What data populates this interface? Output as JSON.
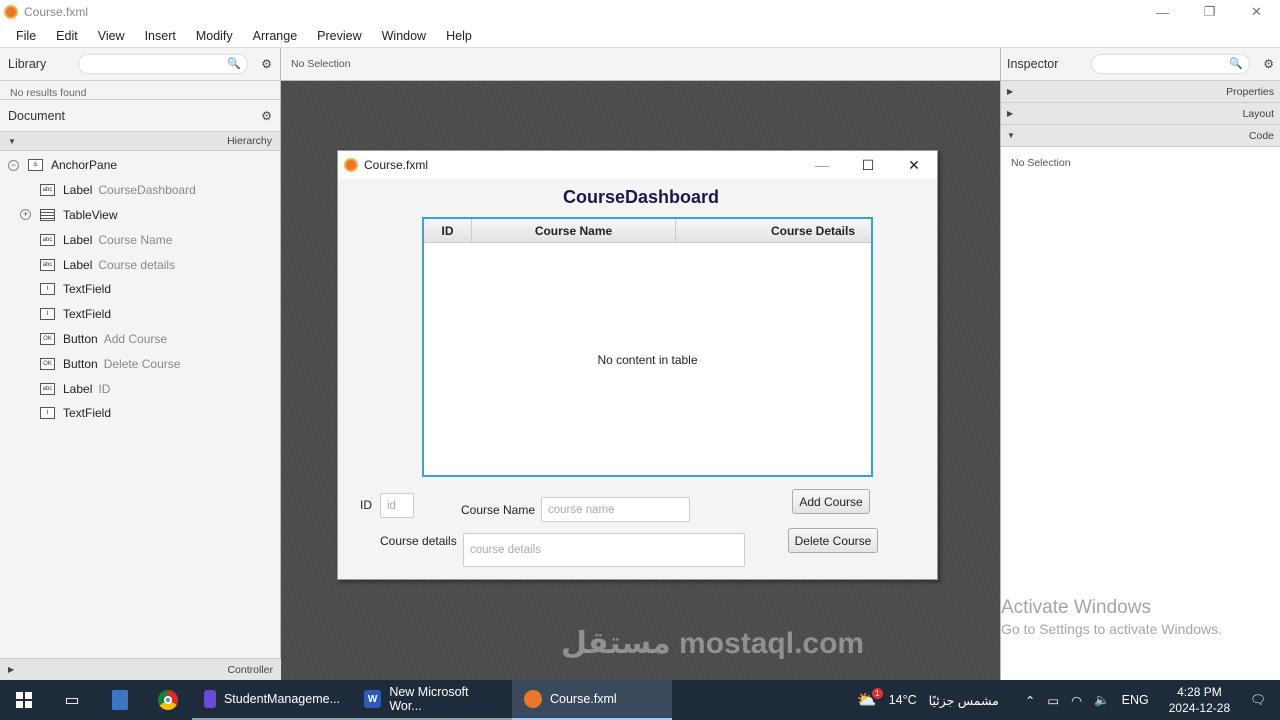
{
  "window": {
    "title": "Course.fxml",
    "minimize": "—",
    "maximize": "❐",
    "close": "✕"
  },
  "menu": [
    "File",
    "Edit",
    "View",
    "Insert",
    "Modify",
    "Arrange",
    "Preview",
    "Window",
    "Help"
  ],
  "library": {
    "label": "Library",
    "no_results": "No results found"
  },
  "document": {
    "label": "Document",
    "hierarchy": "Hierarchy",
    "controller": "Controller",
    "tree": [
      {
        "type": "AnchorPane",
        "text": "",
        "icon": "anchor-icon"
      },
      {
        "type": "Label",
        "text": "CourseDashboard",
        "icon": "abc"
      },
      {
        "type": "TableView",
        "text": "",
        "icon": "table-icon"
      },
      {
        "type": "Label",
        "text": "Course Name",
        "icon": "abc"
      },
      {
        "type": "Label",
        "text": "Course details",
        "icon": "abc"
      },
      {
        "type": "TextField",
        "text": "",
        "icon": "I"
      },
      {
        "type": "TextField",
        "text": "",
        "icon": "I"
      },
      {
        "type": "Button",
        "text": "Add Course",
        "icon": "OK"
      },
      {
        "type": "Button",
        "text": "Delete Course",
        "icon": "OK"
      },
      {
        "type": "Label",
        "text": "ID",
        "icon": "abc"
      },
      {
        "type": "TextField",
        "text": "",
        "icon": "I"
      }
    ]
  },
  "center": {
    "selection": "No Selection"
  },
  "preview": {
    "title": "Course.fxml",
    "minimize": "—",
    "maximize": "☐",
    "close": "✕",
    "heading": "CourseDashboard",
    "columns": [
      "ID",
      "Course Name",
      "Course Details"
    ],
    "empty": "No content in table",
    "id_label": "ID",
    "id_placeholder": "id",
    "name_label": "Course Name",
    "name_placeholder": "course name",
    "details_label": "Course details",
    "details_placeholder": "course details",
    "add_button": "Add Course",
    "delete_button": "Delete Course"
  },
  "inspector": {
    "label": "Inspector",
    "sections": [
      "Properties",
      "Layout",
      "Code"
    ],
    "selection": "No Selection",
    "activate_title": "Activate Windows",
    "activate_sub": "Go to Settings to activate Windows."
  },
  "watermark": "مستقل mostaql.com",
  "taskbar": {
    "apps": [
      {
        "label": "StudentManageme...",
        "icon_color": "#6a4bd8"
      },
      {
        "label": "New Microsoft Wor...",
        "icon_color": "#2b5bb5"
      },
      {
        "label": "Course.fxml",
        "icon_color": "#e8762b"
      }
    ],
    "weather": "14°C",
    "weather_text": "مشمس جزئيًا",
    "badge": "1",
    "lang": "ENG",
    "time": "4:28 PM",
    "date": "2024-12-28"
  }
}
